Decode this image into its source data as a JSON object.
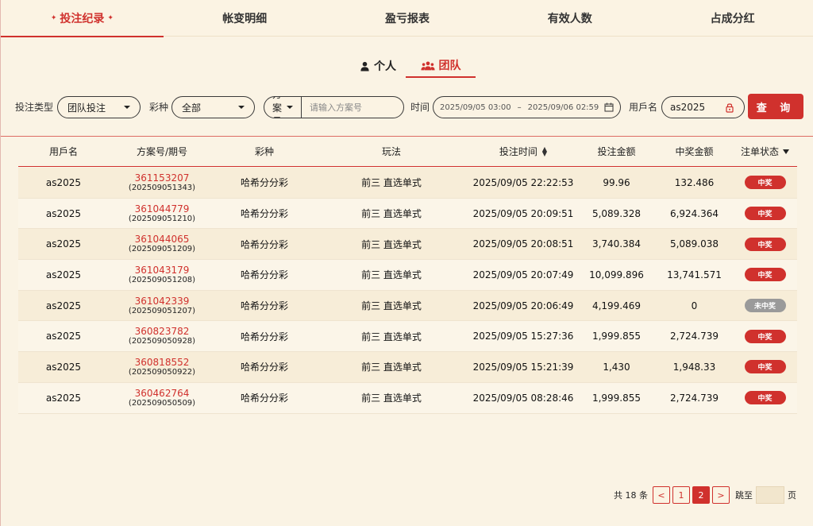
{
  "top_tabs": [
    {
      "label": "投注纪录",
      "active": true
    },
    {
      "label": "帐变明细",
      "active": false
    },
    {
      "label": "盈亏报表",
      "active": false
    },
    {
      "label": "有效人数",
      "active": false
    },
    {
      "label": "占成分红",
      "active": false
    }
  ],
  "sub_tabs": {
    "personal": "个人",
    "team": "团队"
  },
  "filters": {
    "bet_type_label": "投注类型",
    "bet_type_value": "团队投注",
    "lottery_label": "彩种",
    "lottery_value": "全部",
    "plan_select": "方案号",
    "plan_placeholder": "请输入方案号",
    "time_label": "时间",
    "date_start": "2025/09/05 03:00",
    "date_sep": "–",
    "date_end": "2025/09/06 02:59",
    "username_label": "用戶名",
    "username_value": "as2025",
    "search_button": "查 询"
  },
  "table": {
    "headers": [
      "用戶名",
      "方案号/期号",
      "彩种",
      "玩法",
      "投注时间",
      "投注金额",
      "中奖金额",
      "注单状态"
    ],
    "rows": [
      {
        "user": "as2025",
        "plan": "361153207",
        "issue": "(202509051343)",
        "lottery": "哈希分分彩",
        "play": "前三 直选单式",
        "time": "2025/09/05 22:22:53",
        "bet": "99.96",
        "win": "132.486",
        "status": "中奖",
        "won": true
      },
      {
        "user": "as2025",
        "plan": "361044779",
        "issue": "(202509051210)",
        "lottery": "哈希分分彩",
        "play": "前三 直选单式",
        "time": "2025/09/05 20:09:51",
        "bet": "5,089.328",
        "win": "6,924.364",
        "status": "中奖",
        "won": true
      },
      {
        "user": "as2025",
        "plan": "361044065",
        "issue": "(202509051209)",
        "lottery": "哈希分分彩",
        "play": "前三 直选单式",
        "time": "2025/09/05 20:08:51",
        "bet": "3,740.384",
        "win": "5,089.038",
        "status": "中奖",
        "won": true
      },
      {
        "user": "as2025",
        "plan": "361043179",
        "issue": "(202509051208)",
        "lottery": "哈希分分彩",
        "play": "前三 直选单式",
        "time": "2025/09/05 20:07:49",
        "bet": "10,099.896",
        "win": "13,741.571",
        "status": "中奖",
        "won": true
      },
      {
        "user": "as2025",
        "plan": "361042339",
        "issue": "(202509051207)",
        "lottery": "哈希分分彩",
        "play": "前三 直选单式",
        "time": "2025/09/05 20:06:49",
        "bet": "4,199.469",
        "win": "0",
        "status": "未中奖",
        "won": false
      },
      {
        "user": "as2025",
        "plan": "360823782",
        "issue": "(202509050928)",
        "lottery": "哈希分分彩",
        "play": "前三 直选单式",
        "time": "2025/09/05 15:27:36",
        "bet": "1,999.855",
        "win": "2,724.739",
        "status": "中奖",
        "won": true
      },
      {
        "user": "as2025",
        "plan": "360818552",
        "issue": "(202509050922)",
        "lottery": "哈希分分彩",
        "play": "前三 直选单式",
        "time": "2025/09/05 15:21:39",
        "bet": "1,430",
        "win": "1,948.33",
        "status": "中奖",
        "won": true
      },
      {
        "user": "as2025",
        "plan": "360462764",
        "issue": "(202509050509)",
        "lottery": "哈希分分彩",
        "play": "前三 直选单式",
        "time": "2025/09/05 08:28:46",
        "bet": "1,999.855",
        "win": "2,724.739",
        "status": "中奖",
        "won": true
      }
    ]
  },
  "pagination": {
    "total_text": "共 18 条",
    "prev": "<",
    "pages": [
      "1",
      "2"
    ],
    "current": "2",
    "next": ">",
    "goto_label": "跳至",
    "page_unit": "页"
  },
  "colors": {
    "accent": "#d0312d",
    "background": "#faf3e4",
    "lose_badge": "#9a9a9a"
  },
  "icons": {
    "personal": "person-icon",
    "team": "team-icon",
    "calendar": "calendar-icon",
    "lock": "lock-icon"
  }
}
